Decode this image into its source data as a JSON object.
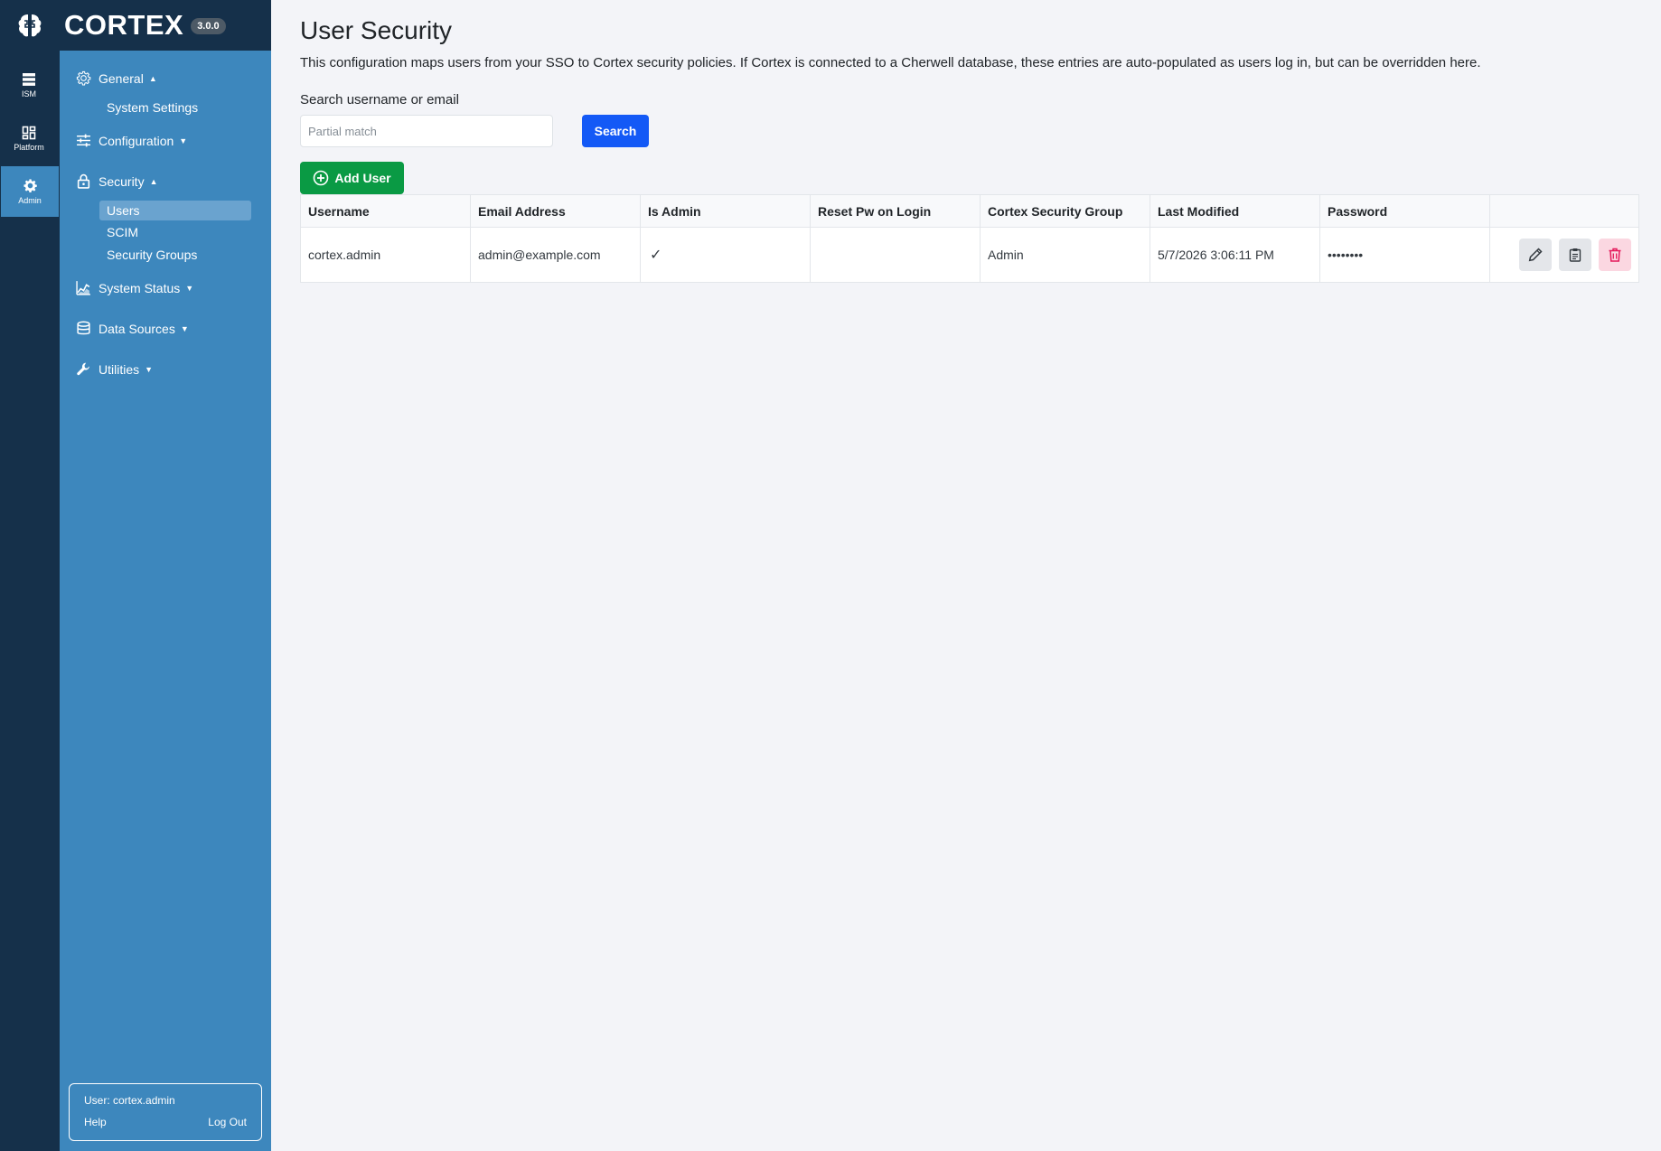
{
  "brand": {
    "name": "CORTEX",
    "version": "3.0.0"
  },
  "rail": [
    {
      "label": "ISM",
      "icon": "server-icon"
    },
    {
      "label": "Platform",
      "icon": "dashboard-icon"
    },
    {
      "label": "Admin",
      "icon": "gear-icon",
      "active": true
    }
  ],
  "sidebar": {
    "general": {
      "label": "General",
      "items": [
        "System Settings"
      ]
    },
    "configuration": {
      "label": "Configuration"
    },
    "security": {
      "label": "Security",
      "items": [
        "Users",
        "SCIM",
        "Security Groups"
      ],
      "active_item": "Users"
    },
    "system_status": {
      "label": "System Status"
    },
    "data_sources": {
      "label": "Data Sources"
    },
    "utilities": {
      "label": "Utilities"
    }
  },
  "user_box": {
    "user_text": "User: cortex.admin",
    "help": "Help",
    "logout": "Log Out"
  },
  "page": {
    "title": "User Security",
    "description": "This configuration maps users from your SSO to Cortex security policies. If Cortex is connected to a Cherwell database, these entries are auto-populated as users log in, but can be overridden here."
  },
  "search": {
    "label": "Search username or email",
    "placeholder": "Partial match",
    "value": "",
    "button": "Search"
  },
  "add_user": {
    "label": "Add User"
  },
  "table": {
    "headers": [
      "Username",
      "Email Address",
      "Is Admin",
      "Reset Pw on Login",
      "Cortex Security Group",
      "Last Modified",
      "Password"
    ],
    "rows": [
      {
        "username": "cortex.admin",
        "email": "admin@example.com",
        "is_admin": "✓",
        "reset_pw": "",
        "group": "Admin",
        "last_modified": "5/7/2026 3:06:11 PM",
        "password": "••••••••"
      }
    ]
  },
  "colors": {
    "rail_bg": "#15304a",
    "sidebar_bg": "#3d87bd",
    "primary": "#1359f6",
    "success": "#0a9a44",
    "danger_bg": "#fbd7e1",
    "danger_icon": "#e4185a"
  }
}
